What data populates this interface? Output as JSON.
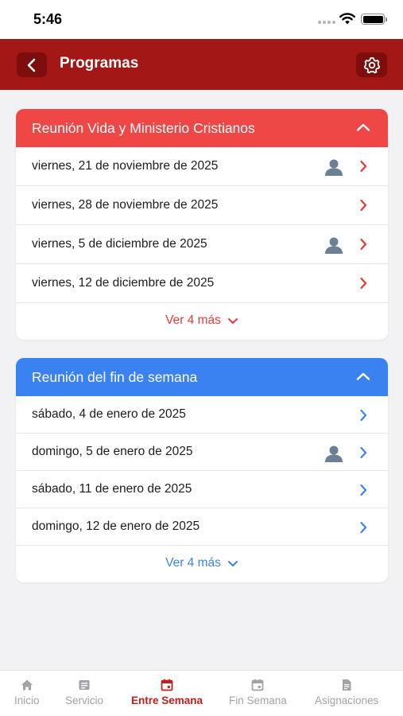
{
  "status_bar": {
    "time": "5:46"
  },
  "header": {
    "title": "Programas"
  },
  "midweek": {
    "title": "Reunión Vida y Ministerio Cristianos",
    "color": "#ef4646",
    "rows": [
      {
        "date": "viernes, 21 de noviembre de 2025",
        "assigned": true
      },
      {
        "date": "viernes, 28 de noviembre de 2025",
        "assigned": false
      },
      {
        "date": "viernes, 5 de diciembre de 2025",
        "assigned": true
      },
      {
        "date": "viernes, 12 de diciembre de 2025",
        "assigned": false
      }
    ],
    "more_label": "Ver 4 más"
  },
  "weekend": {
    "title": "Reunión del fin de semana",
    "color": "#3b82f1",
    "rows": [
      {
        "date": "sábado, 4 de enero de 2025",
        "assigned": false
      },
      {
        "date": "domingo, 5 de enero de 2025",
        "assigned": true
      },
      {
        "date": "sábado, 11 de enero de 2025",
        "assigned": false
      },
      {
        "date": "domingo, 12 de enero de 2025",
        "assigned": false
      }
    ],
    "more_label": "Ver 4 más"
  },
  "tabs": [
    {
      "label": "Inicio",
      "icon": "home-icon",
      "active": false
    },
    {
      "label": "Servicio",
      "icon": "service-icon",
      "active": false
    },
    {
      "label": "Entre Semana",
      "icon": "calendar-icon",
      "active": true
    },
    {
      "label": "Fin Semana",
      "icon": "calendar-icon",
      "active": false
    },
    {
      "label": "Asignaciones",
      "icon": "document-icon",
      "active": false
    }
  ],
  "colors": {
    "header": "#a31717",
    "active_tab": "#c31d1d"
  }
}
